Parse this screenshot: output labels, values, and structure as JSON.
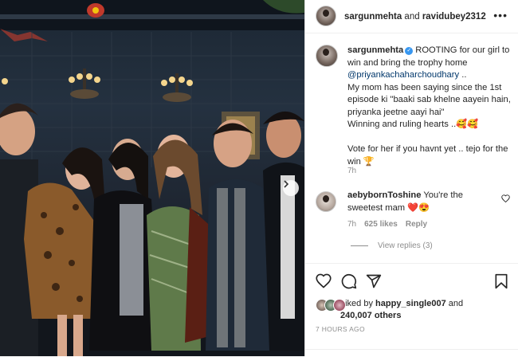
{
  "post": {
    "header": {
      "author": "sargunmehta",
      "joiner": "and",
      "collaborator": "ravidubey2312",
      "more_icon": "more-horizontal-icon"
    },
    "caption": {
      "author": "sargunmehta",
      "text_1": "ROOTING for our girl to win and bring the trophy home",
      "mention": "@priyankachaharchoudhary",
      "text_2": "..",
      "line_3": "My mom has been saying since the 1st episode ki \"baaki sab khelne aayein hain, priyanka jeetne aayi hai\"",
      "line_4": "Winning and ruling hearts ..🥰🥰",
      "line_5": "Vote for her if you havnt yet .. tejo for the win 🏆",
      "time": "7h"
    },
    "comment": {
      "author": "aebybornToshine",
      "text": "You're the sweetest mam ❤️😍",
      "time": "7h",
      "likes": "625 likes",
      "reply": "Reply",
      "view_replies": "View replies (3)"
    },
    "actions": {
      "like_icon": "heart-icon",
      "comment_icon": "comment-icon",
      "share_icon": "share-icon",
      "save_icon": "bookmark-icon"
    },
    "likes": {
      "prefix": "Liked by",
      "user": "happy_single007",
      "joiner": "and",
      "count": "240,007 others"
    },
    "posted_ago": "7 HOURS AGO",
    "accent_color": "#3897f0"
  }
}
